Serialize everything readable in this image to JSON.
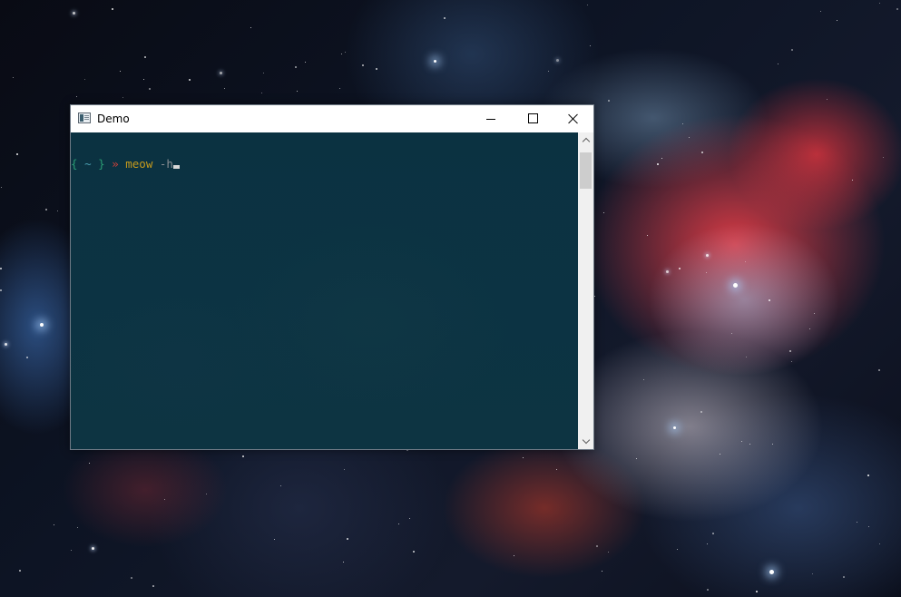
{
  "window": {
    "title": "Demo",
    "app_icon": "terminal-app-icon",
    "controls": {
      "minimize_icon": "minimize-icon",
      "maximize_icon": "maximize-icon",
      "close_icon": "close-icon"
    }
  },
  "terminal": {
    "prompt_open": "{",
    "prompt_dir": "~",
    "prompt_close": "}",
    "prompt_arrow": "»",
    "command": "meow",
    "argument": "-h",
    "colors": {
      "background": "#0c3343",
      "brace": "#2a9d74",
      "dir": "#4b9fb1",
      "arrow": "#c8403a",
      "command": "#c59a1d",
      "argument": "#8a8f94"
    }
  },
  "scrollbar": {
    "up_icon": "scroll-up-arrow-icon",
    "down_icon": "scroll-down-arrow-icon"
  },
  "desktop": {
    "wallpaper": "orion-nebula"
  }
}
